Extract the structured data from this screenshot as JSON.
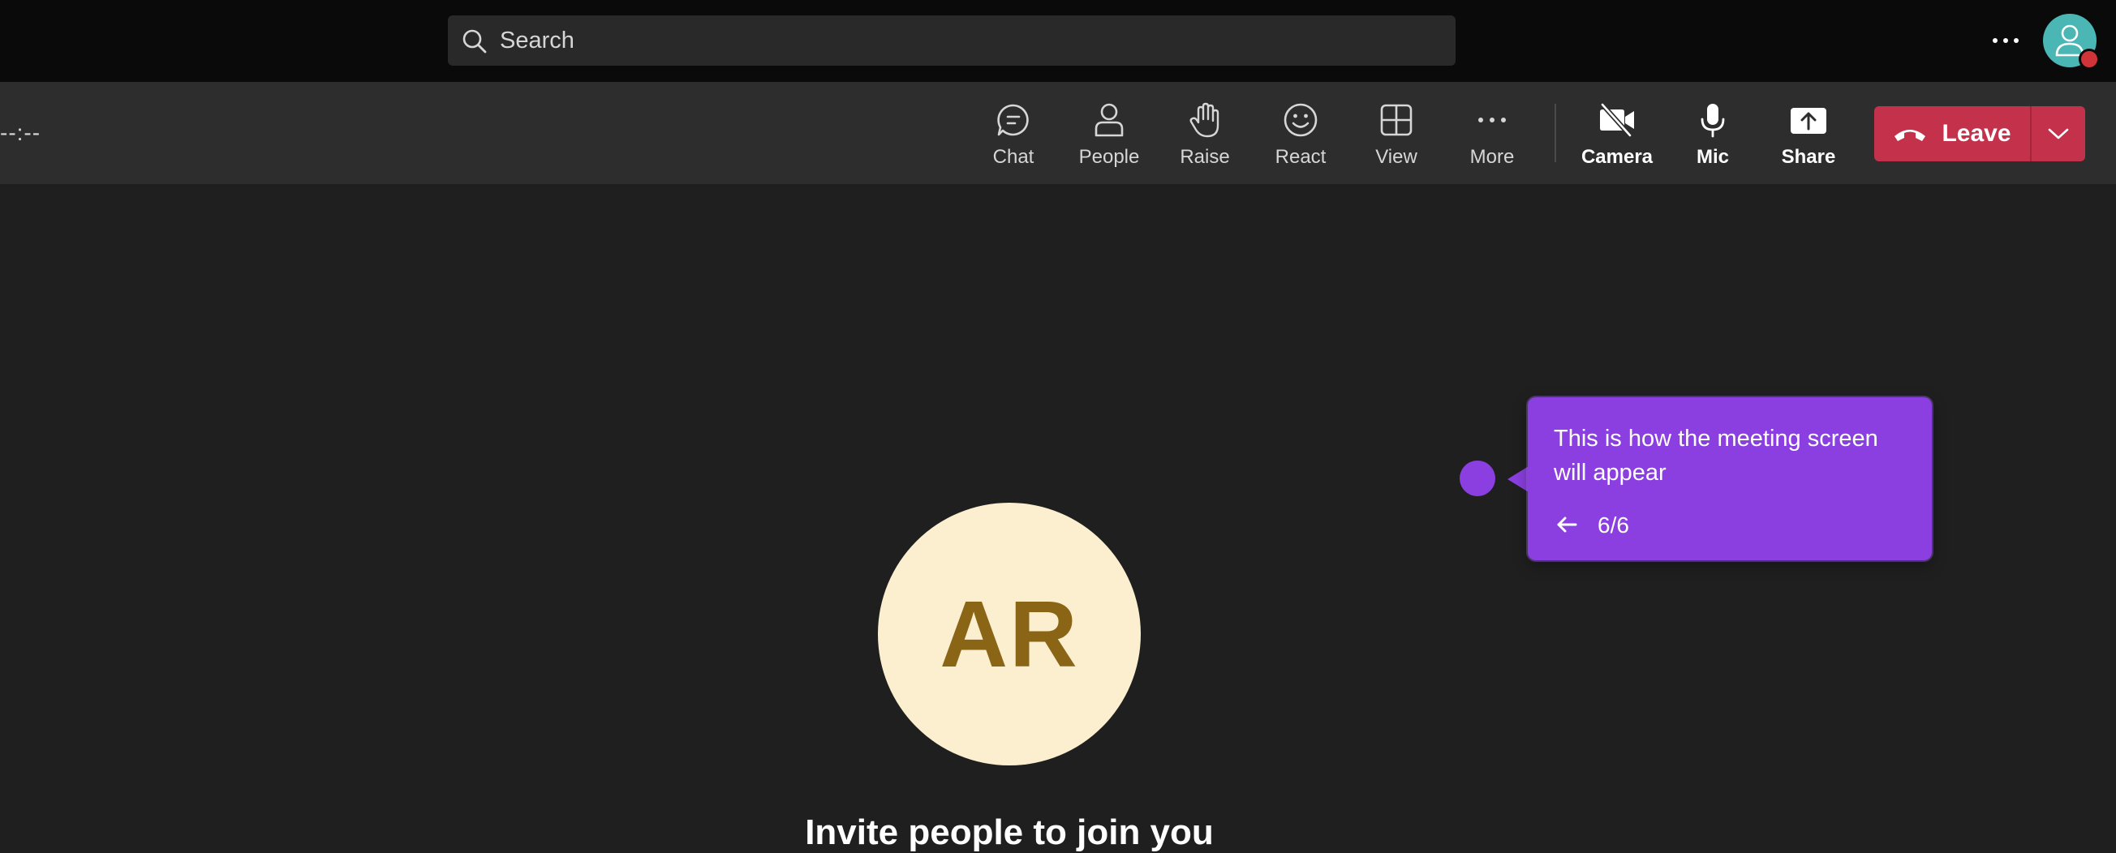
{
  "search": {
    "placeholder": "Search"
  },
  "meeting": {
    "timer": "--:--"
  },
  "toolbar": {
    "chat": "Chat",
    "people": "People",
    "raise": "Raise",
    "react": "React",
    "view": "View",
    "more": "More",
    "camera": "Camera",
    "mic": "Mic",
    "share": "Share",
    "leave": "Leave"
  },
  "stage": {
    "initials": "AR",
    "invite_title": "Invite people to join you"
  },
  "tour": {
    "message": "This is how the meeting screen will appear",
    "step": "6/6"
  },
  "colors": {
    "leave_red": "#c4314b",
    "tour_purple": "#8b3fe0",
    "avatar_bg": "#fcefd0",
    "avatar_text": "#8a6516",
    "presence_busy": "#d13438"
  },
  "icons": {
    "search": "search-icon",
    "more": "more-horizontal-icon",
    "chat": "chat-bubble-icon",
    "people": "person-icon",
    "raise": "hand-icon",
    "react": "smiley-icon",
    "view": "grid-icon",
    "camera": "camera-off-icon",
    "mic": "microphone-icon",
    "share": "share-arrow-up-icon",
    "leave": "phone-hangup-icon",
    "back": "arrow-left-icon"
  }
}
